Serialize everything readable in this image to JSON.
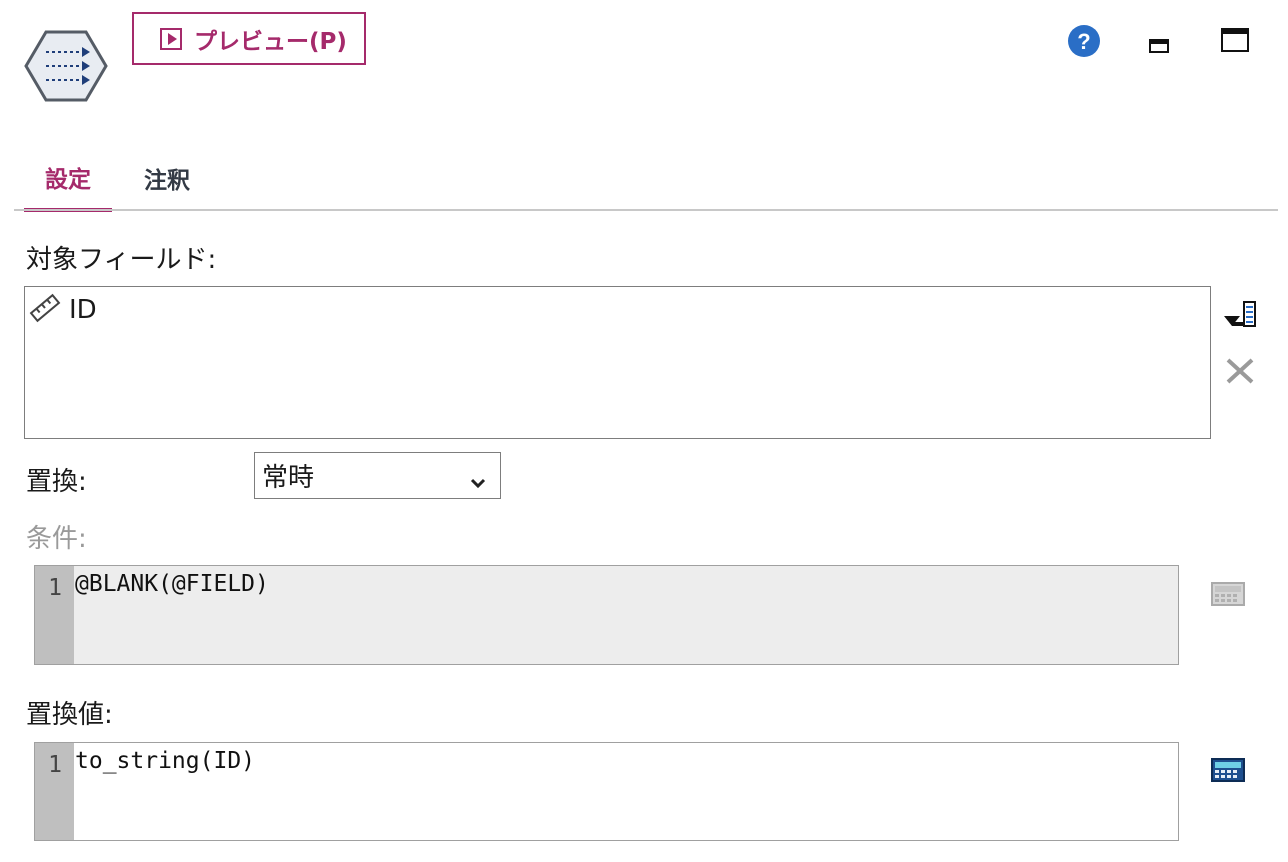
{
  "header": {
    "node_icon": "field-reorder-node-icon",
    "preview_button_label": "プレビュー(P)",
    "preview_icon": "play-icon",
    "help_icon": "help-icon",
    "minimize_icon": "minimize-icon",
    "maximize_icon": "maximize-icon"
  },
  "tabs": [
    {
      "label": "設定",
      "active": true
    },
    {
      "label": "注釈",
      "active": false
    }
  ],
  "target_fields": {
    "label": "対象フィールド:",
    "items": [
      {
        "name": "ID",
        "icon": "continuous-field-ruler-icon"
      }
    ],
    "picker_icon": "field-picker-icon",
    "delete_icon": "delete-icon"
  },
  "replace": {
    "label": "置換:",
    "selected": "常時"
  },
  "condition": {
    "label": "条件:",
    "line_number": "1",
    "code": "@BLANK(@FIELD)",
    "calculator_icon": "expression-builder-icon"
  },
  "replacement_value": {
    "label": "置換値:",
    "line_number": "1",
    "code": "to_string(ID)",
    "calculator_icon": "expression-builder-icon"
  },
  "colors": {
    "accent": "#a52a6b",
    "help_blue": "#2a6ec6",
    "disabled_text": "#9a9a9a"
  }
}
